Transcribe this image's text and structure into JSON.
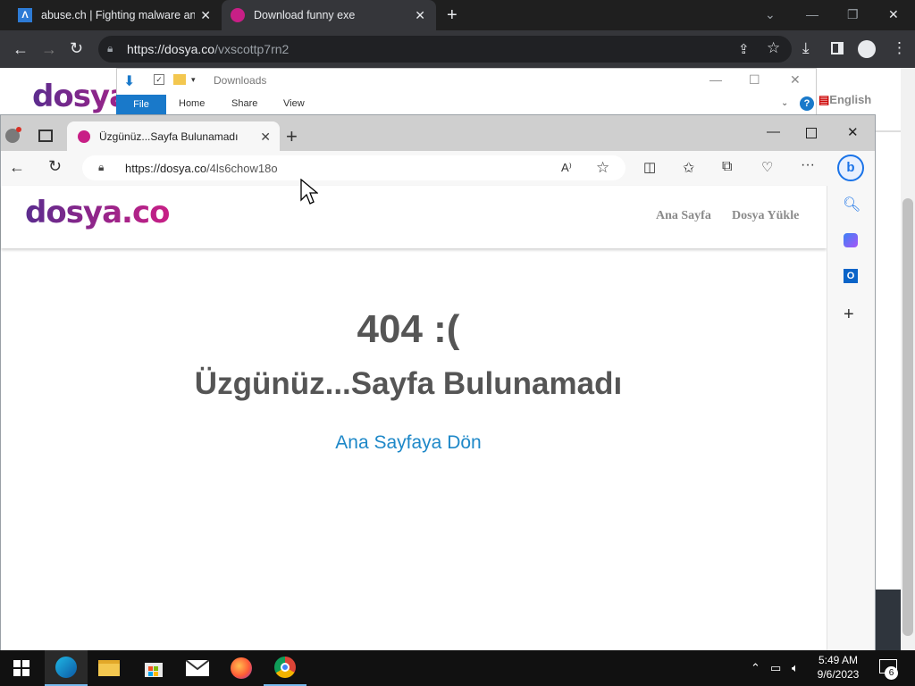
{
  "chrome": {
    "tabs": [
      {
        "title": "abuse.ch | Fighting malware and"
      },
      {
        "title": "Download funny exe"
      }
    ],
    "url_host": "https://dosya.co",
    "url_path": "/vxscottp7rn2",
    "site_logo": "dosya.co",
    "english_label": "English"
  },
  "explorer": {
    "title": "Downloads",
    "ribbon": [
      "File",
      "Home",
      "Share",
      "View"
    ]
  },
  "edge": {
    "tab_title": "Üzgünüz...Sayfa Bulunamadı",
    "url_host": "https://dosya.co",
    "url_path": "/4ls6chow18o"
  },
  "site": {
    "logo": "dosya.co",
    "nav": [
      "Ana Sayfa",
      "Dosya Yükle"
    ],
    "error_code": "404 :(",
    "error_message": "Üzgünüz...Sayfa Bulunamadı",
    "home_link": "Ana Sayfaya Dön"
  },
  "taskbar": {
    "time": "5:49 AM",
    "date": "9/6/2023",
    "notification_count": "6"
  },
  "colors": {
    "link_blue": "#1e88c8",
    "explorer_file_tab": "#1979ca",
    "logo_gradient_start": "#5b2c8e",
    "logo_gradient_end": "#c81f86"
  }
}
